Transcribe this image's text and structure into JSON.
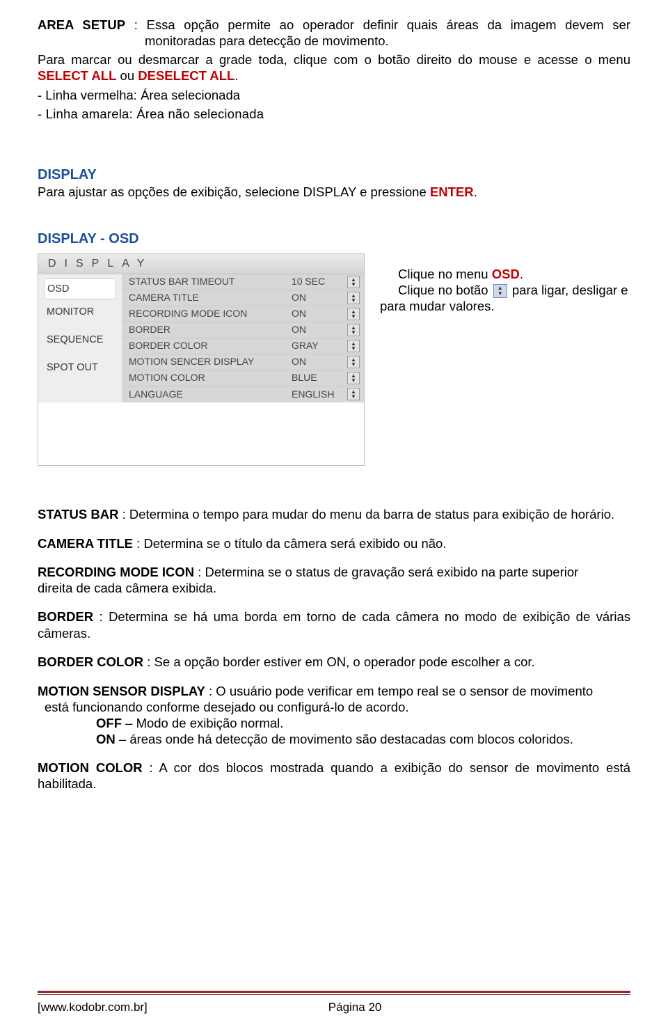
{
  "top": {
    "area_setup_label": "AREA SETUP",
    "area_setup_sep": " : ",
    "area_setup_text1": "Essa opção permite ao operador definir quais áreas da imagem devem ser monitoradas para detecção de movimento.",
    "area_setup_text2_a": " Para marcar ou desmarcar a grade toda, clique com o botão direito do mouse e acesse o menu ",
    "area_setup_text2_b": "SELECT ALL",
    "area_setup_text2_c": " ou ",
    "area_setup_text2_d": "DESELECT ALL",
    "area_setup_text2_e": ".",
    "red_line": "- Linha vermelha: Área selecionada",
    "yellow_line": "- Linha amarela: Área não selecionada"
  },
  "display": {
    "heading": "DISPLAY",
    "intro_a": "Para ajustar as opções de exibição, selecione DISPLAY e pressione ",
    "intro_b": "ENTER",
    "intro_c": ".",
    "osd_heading": "DISPLAY - OSD"
  },
  "osd_panel": {
    "title": "DISPLAY",
    "left": [
      "OSD",
      "MONITOR",
      "SEQUENCE",
      "SPOT OUT"
    ],
    "settings": [
      {
        "label": "STATUS BAR TIMEOUT",
        "value": "10 SEC"
      },
      {
        "label": "CAMERA TITLE",
        "value": "ON"
      },
      {
        "label": "RECORDING MODE ICON",
        "value": "ON"
      },
      {
        "label": "BORDER",
        "value": "ON"
      },
      {
        "label": "BORDER COLOR",
        "value": "GRAY"
      },
      {
        "label": "MOTION SENCER DISPLAY",
        "value": "ON"
      },
      {
        "label": "MOTION COLOR",
        "value": "BLUE"
      },
      {
        "label": "LANGUAGE",
        "value": "ENGLISH"
      }
    ]
  },
  "osd_side": {
    "line1_a": "Clique no menu ",
    "line1_b": "OSD",
    "line1_c": ".",
    "line2_a": "Clique no botão ",
    "line2_b": "  para ligar, desligar e para mudar valores."
  },
  "defs": {
    "status_bar_term": "STATUS BAR",
    "status_bar_text": " : Determina o tempo para mudar do menu da barra de status para exibição de horário.",
    "camera_title_term": "CAMERA TITLE",
    "camera_title_text": " : Determina se o título da câmera será exibido ou não.",
    "rec_mode_term": "RECORDING MODE ICON",
    "rec_mode_text_a": " : Determina se o status de gravação será exibido na parte superior",
    "rec_mode_text_b": "direita de cada câmera exibida.",
    "border_term": "BORDER",
    "border_text": " : Determina se há uma borda em torno de cada câmera no modo de exibição de várias   câmeras.",
    "border_color_term": "BORDER COLOR",
    "border_color_text": " : Se a opção border estiver em ON, o operador pode escolher a cor.",
    "motion_sensor_term": "MOTION SENSOR DISPLAY",
    "motion_sensor_text_a": " : O usuário pode verificar em tempo real se o sensor de movimento",
    "motion_sensor_text_b": " está funcionando conforme desejado ou configurá-lo de acordo.",
    "off_label": "OFF",
    "off_text": " – Modo de exibição normal.",
    "on_label": "ON",
    "on_text": " – áreas onde há detecção de movimento são destacadas com blocos coloridos.",
    "motion_color_term": "MOTION COLOR",
    "motion_color_text": " : A cor dos blocos mostrada quando a exibição do sensor de movimento está habilitada."
  },
  "footer": {
    "site": "[www.kodobr.com.br]",
    "page": "Página 20"
  }
}
